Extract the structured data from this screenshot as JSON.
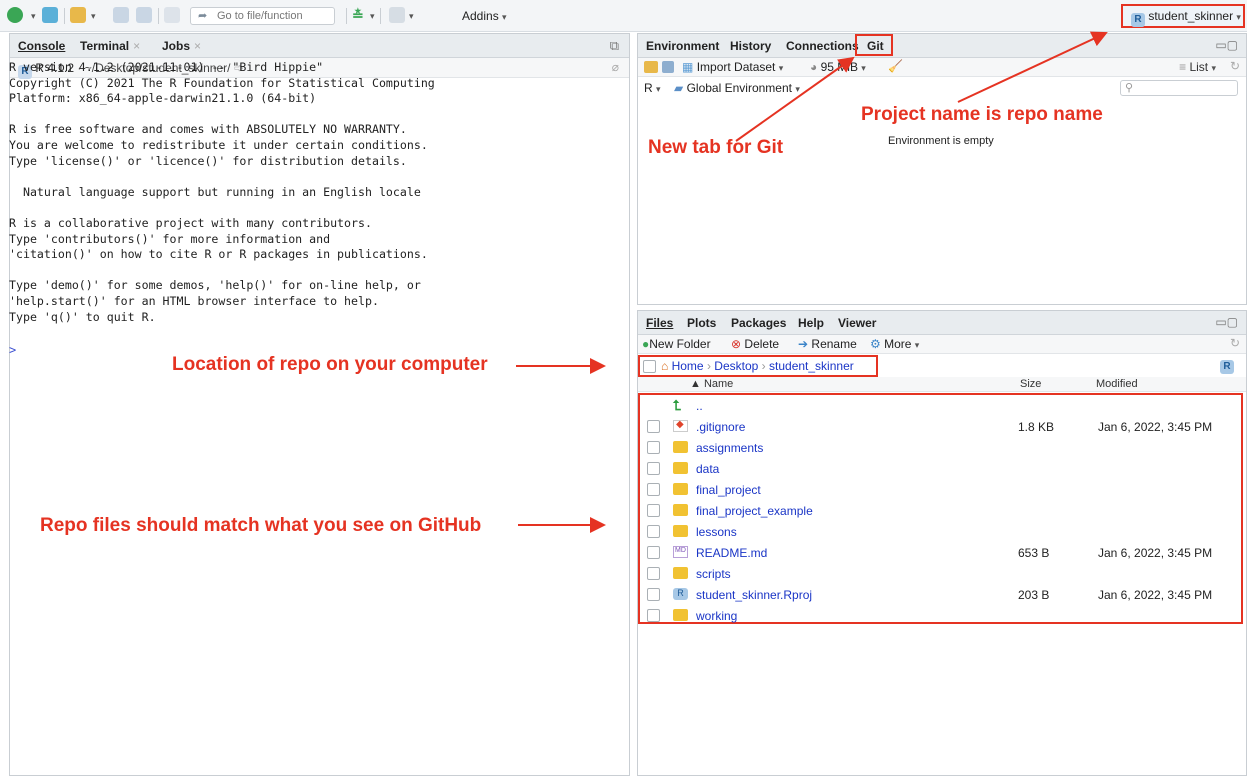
{
  "toolbar": {
    "goto_placeholder": "Go to file/function",
    "addins_label": "Addins",
    "project_name": "student_skinner"
  },
  "console_pane": {
    "tabs": [
      "Console",
      "Terminal",
      "Jobs"
    ],
    "r_version": "R 4.1.2",
    "path": "~/Desktop/student_skinner/",
    "text": "R version 4.1.2 (2021-11-01) -- \"Bird Hippie\"\nCopyright (C) 2021 The R Foundation for Statistical Computing\nPlatform: x86_64-apple-darwin21.1.0 (64-bit)\n\nR is free software and comes with ABSOLUTELY NO WARRANTY.\nYou are welcome to redistribute it under certain conditions.\nType 'license()' or 'licence()' for distribution details.\n\n  Natural language support but running in an English locale\n\nR is a collaborative project with many contributors.\nType 'contributors()' for more information and\n'citation()' on how to cite R or R packages in publications.\n\nType 'demo()' for some demos, 'help()' for on-line help, or\n'help.start()' for an HTML browser interface to help.\nType 'q()' to quit R.",
    "prompt": ">"
  },
  "env_pane": {
    "tabs": [
      "Environment",
      "History",
      "Connections",
      "Git"
    ],
    "import_dataset": "Import Dataset",
    "memory": "95 MiB",
    "list_label": "List",
    "r_selector": "R",
    "global_env": "Global Environment",
    "empty_message": "Environment is empty"
  },
  "files_pane": {
    "tabs": [
      "Files",
      "Plots",
      "Packages",
      "Help",
      "Viewer"
    ],
    "toolbar": {
      "new_folder": "New Folder",
      "delete": "Delete",
      "rename": "Rename",
      "more": "More"
    },
    "breadcrumb": [
      "Home",
      "Desktop",
      "student_skinner"
    ],
    "columns": {
      "name": "Name",
      "size": "Size",
      "modified": "Modified"
    },
    "parent": "..",
    "files": [
      {
        "name": ".gitignore",
        "type": "git",
        "size": "1.8 KB",
        "modified": "Jan 6, 2022, 3:45 PM"
      },
      {
        "name": "assignments",
        "type": "folder",
        "size": "",
        "modified": ""
      },
      {
        "name": "data",
        "type": "folder",
        "size": "",
        "modified": ""
      },
      {
        "name": "final_project",
        "type": "folder",
        "size": "",
        "modified": ""
      },
      {
        "name": "final_project_example",
        "type": "folder",
        "size": "",
        "modified": ""
      },
      {
        "name": "lessons",
        "type": "folder",
        "size": "",
        "modified": ""
      },
      {
        "name": "README.md",
        "type": "md",
        "size": "653 B",
        "modified": "Jan 6, 2022, 3:45 PM"
      },
      {
        "name": "scripts",
        "type": "folder",
        "size": "",
        "modified": ""
      },
      {
        "name": "student_skinner.Rproj",
        "type": "rproj",
        "size": "203 B",
        "modified": "Jan 6, 2022, 3:45 PM"
      },
      {
        "name": "working",
        "type": "folder",
        "size": "",
        "modified": ""
      }
    ]
  },
  "annotations": {
    "git_tab": "New tab for Git",
    "project_name": "Project name is repo name",
    "location": "Location of repo on your computer",
    "repo_files": "Repo files should match what you see on GitHub"
  },
  "colors": {
    "annotation": "#e53322",
    "link": "#1a35c6",
    "folder": "#f1c232"
  }
}
